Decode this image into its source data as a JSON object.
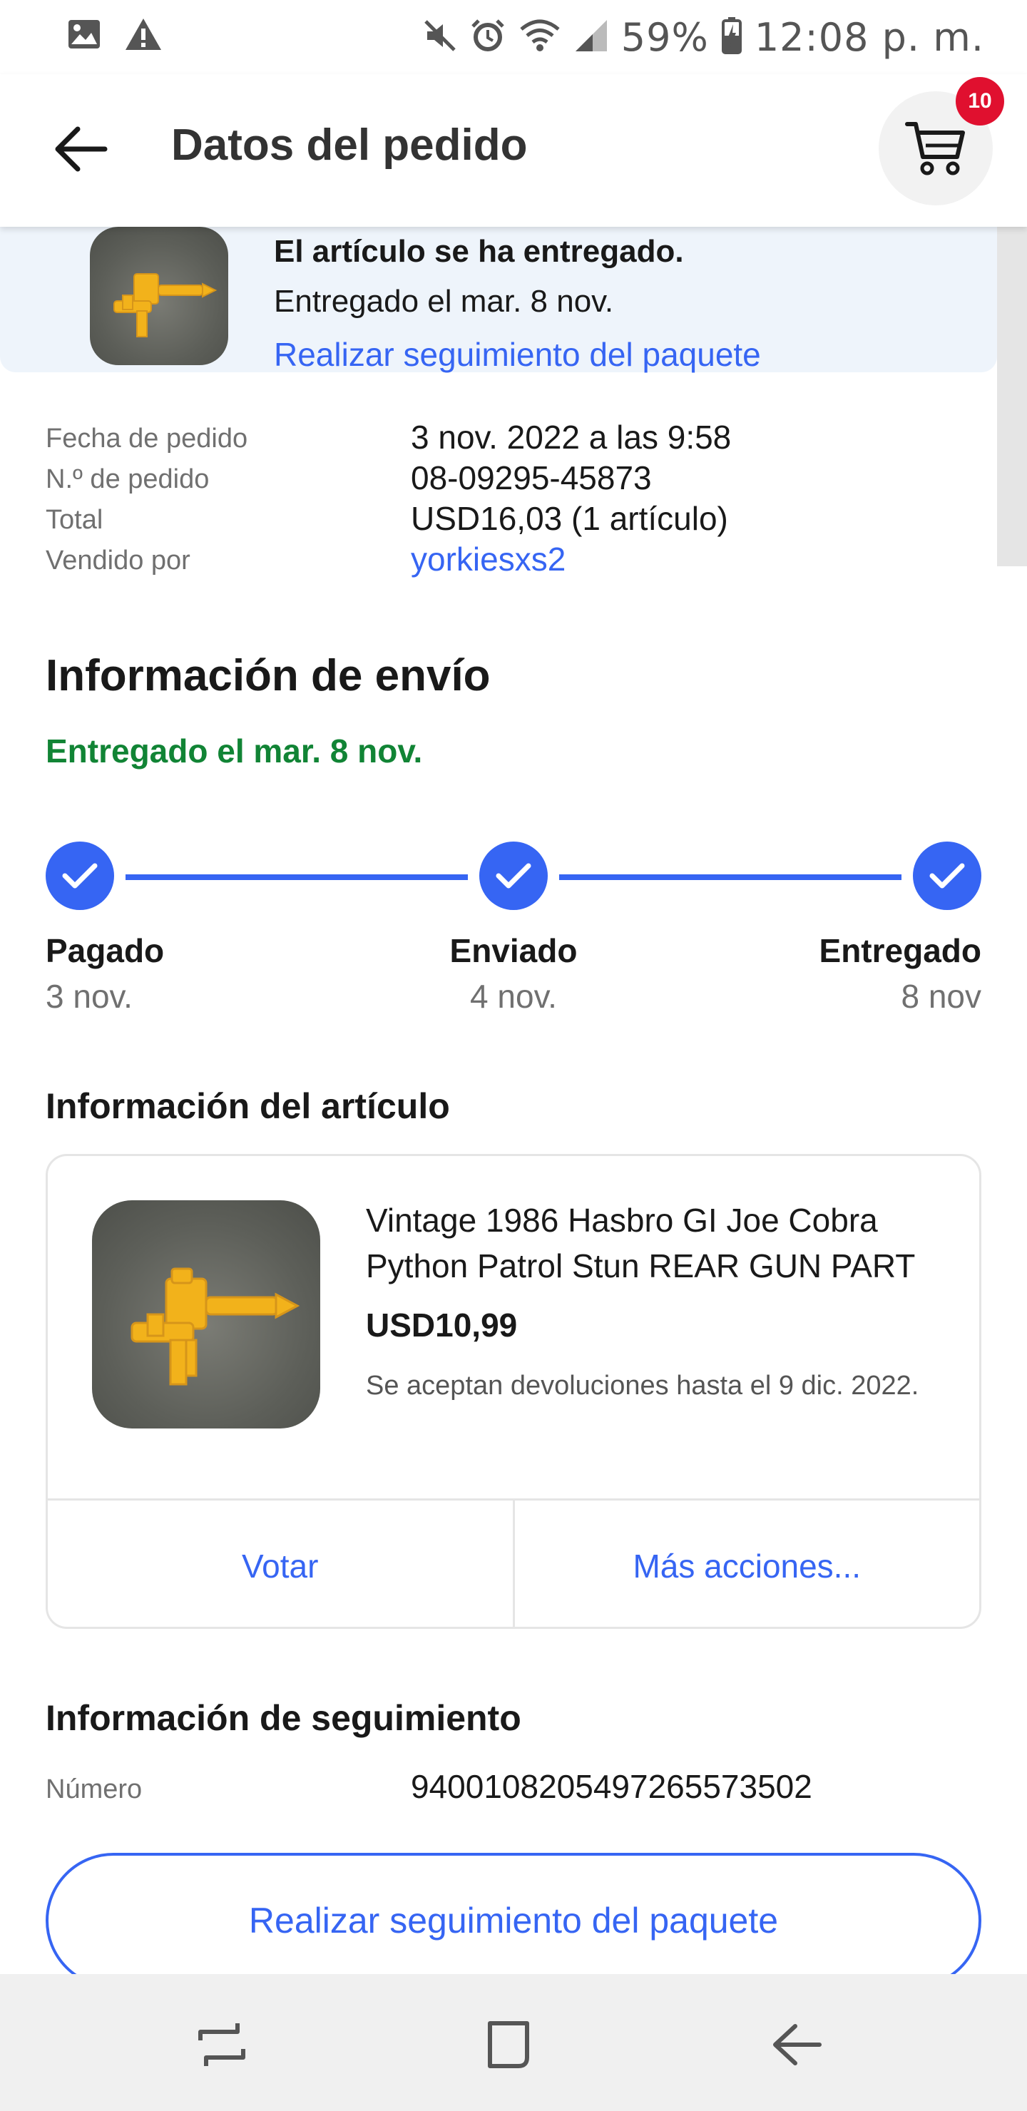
{
  "status_bar": {
    "battery": "59%",
    "time": "12:08 p. m.",
    "icons": [
      "image-icon",
      "warning-icon",
      "mute-icon",
      "alarm-icon",
      "wifi-icon",
      "signal-icon",
      "battery-icon"
    ]
  },
  "header": {
    "title": "Datos del pedido",
    "cart_count": "10"
  },
  "banner": {
    "status": "El artículo se ha entregado.",
    "delivered": "Entregado el mar. 8 nov.",
    "track_link": "Realizar seguimiento del paquete"
  },
  "order": {
    "rows": [
      {
        "label": "Fecha de pedido",
        "value": "3 nov. 2022 a las 9:58"
      },
      {
        "label": "N.º de pedido",
        "value": "08-09295-45873"
      },
      {
        "label": "Total",
        "value": "USD16,03 (1 artículo)"
      },
      {
        "label": "Vendido por",
        "value": "yorkiesxs2"
      }
    ]
  },
  "shipping": {
    "heading": "Información de envío",
    "status": "Entregado el mar. 8 nov.",
    "steps": [
      {
        "label": "Pagado",
        "date": "3 nov."
      },
      {
        "label": "Enviado",
        "date": "4 nov."
      },
      {
        "label": "Entregado",
        "date": "8 nov"
      }
    ]
  },
  "item": {
    "heading": "Información del artículo",
    "title": "Vintage 1986 Hasbro GI Joe Cobra Python Patrol Stun REAR GUN PART",
    "price": "USD10,99",
    "returns": "Se aceptan devoluciones hasta el 9 dic. 2022.",
    "actions": [
      "Votar",
      "Más acciones..."
    ]
  },
  "tracking": {
    "heading": "Información de seguimiento",
    "number_label": "Número",
    "number": "9400108205497265573502",
    "button": "Realizar seguimiento del paquete"
  },
  "colors": {
    "accent": "#3665f3",
    "success": "#118435",
    "badge": "#e0102f",
    "banner_bg": "#eef4fb"
  }
}
